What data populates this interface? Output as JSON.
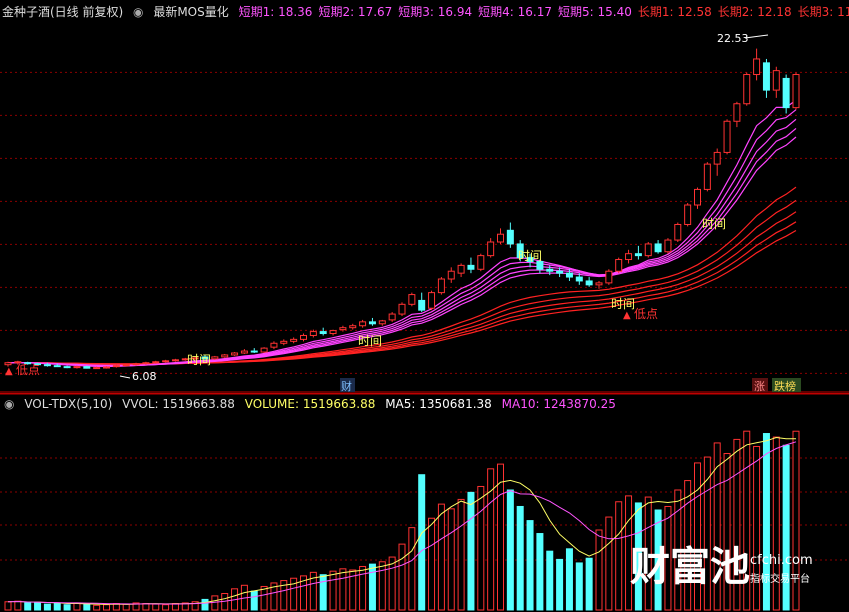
{
  "header": {
    "stock_title": "金种子酒(日线 前复权)",
    "indicator_name": "最新MOS量化",
    "values": [
      {
        "label": "短期1: 18.36",
        "color": "#ff55ff"
      },
      {
        "label": "短期2: 17.67",
        "color": "#ff55ff"
      },
      {
        "label": "短期3: 16.94",
        "color": "#ff55ff"
      },
      {
        "label": "短期4: 16.17",
        "color": "#ff55ff"
      },
      {
        "label": "短期5: 15.40",
        "color": "#ff55ff"
      },
      {
        "label": "长期1: 12.58",
        "color": "#ff3333"
      },
      {
        "label": "长期2: 12.18",
        "color": "#ff3333"
      },
      {
        "label": "长期3: 11",
        "color": "#ff3333"
      }
    ]
  },
  "volume_header": {
    "name": "VOL-TDX(5,10)",
    "vvol": "VVOL: 1519663.88",
    "volume": "VOLUME: 1519663.88",
    "ma5": "MA5: 1350681.38",
    "ma10": "MA10: 1243870.25"
  },
  "annotations": {
    "high_label": "22.53",
    "low_label": "6.08",
    "time_label": "时间",
    "low_point_label": "低点",
    "cai_label": "财",
    "zhang_label": "涨",
    "diebang_label": "跌榜"
  },
  "watermark": {
    "main": "财富池",
    "domain": "cfchi.com",
    "sub": "指标交易平台"
  },
  "colors": {
    "up": "#ff3232",
    "down": "#54ffff",
    "short_ma": "#ff44ff",
    "long_ma": "#ff2222",
    "grid": "#8b0000",
    "label": "#ffff66"
  },
  "chart_data": [
    {
      "type": "candlestick",
      "title": "金种子酒(日线 前复权)",
      "ylim": [
        5.0,
        24.0
      ],
      "ohlc": [
        [
          6.3,
          6.45,
          6.2,
          6.4
        ],
        [
          6.4,
          6.5,
          6.3,
          6.45
        ],
        [
          6.4,
          6.45,
          6.3,
          6.35
        ],
        [
          6.35,
          6.4,
          6.25,
          6.3
        ],
        [
          6.3,
          6.4,
          6.2,
          6.25
        ],
        [
          6.25,
          6.35,
          6.18,
          6.22
        ],
        [
          6.2,
          6.25,
          6.12,
          6.15
        ],
        [
          6.15,
          6.25,
          6.1,
          6.2
        ],
        [
          6.2,
          6.25,
          6.1,
          6.12
        ],
        [
          6.12,
          6.2,
          6.08,
          6.15
        ],
        [
          6.15,
          6.22,
          6.1,
          6.18
        ],
        [
          6.2,
          6.3,
          6.15,
          6.25
        ],
        [
          6.25,
          6.35,
          6.2,
          6.3
        ],
        [
          6.3,
          6.4,
          6.25,
          6.35
        ],
        [
          6.35,
          6.45,
          6.3,
          6.4
        ],
        [
          6.4,
          6.5,
          6.35,
          6.45
        ],
        [
          6.45,
          6.55,
          6.4,
          6.5
        ],
        [
          6.5,
          6.6,
          6.45,
          6.55
        ],
        [
          6.55,
          6.65,
          6.5,
          6.6
        ],
        [
          6.6,
          6.7,
          6.55,
          6.65
        ],
        [
          6.7,
          6.8,
          6.6,
          6.6
        ],
        [
          6.6,
          6.75,
          6.55,
          6.7
        ],
        [
          6.7,
          6.85,
          6.65,
          6.8
        ],
        [
          6.8,
          6.95,
          6.75,
          6.9
        ],
        [
          6.9,
          7.1,
          6.85,
          7.0
        ],
        [
          7.0,
          7.15,
          6.9,
          6.95
        ],
        [
          6.95,
          7.2,
          6.9,
          7.15
        ],
        [
          7.2,
          7.5,
          7.1,
          7.4
        ],
        [
          7.4,
          7.6,
          7.3,
          7.5
        ],
        [
          7.5,
          7.7,
          7.4,
          7.6
        ],
        [
          7.6,
          7.9,
          7.5,
          7.8
        ],
        [
          7.8,
          8.1,
          7.7,
          8.0
        ],
        [
          8.0,
          8.2,
          7.8,
          7.9
        ],
        [
          7.9,
          8.1,
          7.8,
          8.05
        ],
        [
          8.1,
          8.3,
          8.0,
          8.2
        ],
        [
          8.2,
          8.4,
          8.1,
          8.3
        ],
        [
          8.3,
          8.6,
          8.2,
          8.5
        ],
        [
          8.5,
          8.7,
          8.3,
          8.4
        ],
        [
          8.4,
          8.6,
          8.3,
          8.55
        ],
        [
          8.6,
          9.0,
          8.5,
          8.9
        ],
        [
          8.9,
          9.5,
          8.8,
          9.4
        ],
        [
          9.4,
          10.0,
          9.3,
          9.9
        ],
        [
          9.6,
          10.0,
          9.0,
          9.1
        ],
        [
          9.2,
          10.1,
          9.1,
          10.0
        ],
        [
          10.0,
          10.8,
          9.9,
          10.7
        ],
        [
          10.7,
          11.3,
          10.5,
          11.1
        ],
        [
          11.0,
          11.5,
          10.8,
          11.4
        ],
        [
          11.4,
          11.8,
          11.0,
          11.2
        ],
        [
          11.2,
          12.0,
          11.1,
          11.9
        ],
        [
          11.9,
          12.8,
          11.8,
          12.6
        ],
        [
          12.6,
          13.3,
          12.5,
          13.0
        ],
        [
          13.2,
          13.6,
          12.3,
          12.5
        ],
        [
          12.5,
          12.7,
          11.6,
          11.8
        ],
        [
          11.8,
          12.0,
          11.3,
          11.6
        ],
        [
          11.6,
          11.7,
          11.0,
          11.2
        ],
        [
          11.2,
          11.4,
          10.9,
          11.1
        ],
        [
          11.1,
          11.3,
          10.8,
          11.0
        ],
        [
          11.0,
          11.2,
          10.6,
          10.8
        ],
        [
          10.8,
          11.0,
          10.4,
          10.6
        ],
        [
          10.6,
          10.8,
          10.3,
          10.4
        ],
        [
          10.4,
          10.6,
          10.2,
          10.5
        ],
        [
          10.5,
          11.2,
          10.4,
          11.1
        ],
        [
          11.1,
          11.8,
          11.0,
          11.7
        ],
        [
          11.7,
          12.2,
          11.5,
          12.0
        ],
        [
          12.0,
          12.4,
          11.7,
          11.9
        ],
        [
          11.9,
          12.6,
          11.8,
          12.5
        ],
        [
          12.5,
          12.7,
          12.0,
          12.1
        ],
        [
          12.1,
          12.8,
          12.0,
          12.7
        ],
        [
          12.7,
          13.6,
          12.6,
          13.5
        ],
        [
          13.5,
          14.6,
          13.4,
          14.5
        ],
        [
          14.5,
          15.4,
          14.3,
          15.3
        ],
        [
          15.3,
          16.7,
          15.2,
          16.6
        ],
        [
          16.6,
          17.4,
          16.0,
          17.2
        ],
        [
          17.2,
          18.9,
          17.1,
          18.8
        ],
        [
          18.8,
          19.8,
          18.5,
          19.7
        ],
        [
          19.7,
          21.3,
          19.6,
          21.2
        ],
        [
          21.2,
          22.53,
          20.9,
          22.0
        ],
        [
          21.8,
          22.0,
          20.0,
          20.4
        ],
        [
          20.4,
          21.6,
          20.0,
          21.4
        ],
        [
          21.0,
          21.2,
          19.2,
          19.5
        ],
        [
          19.5,
          21.3,
          19.4,
          21.2
        ]
      ]
    },
    {
      "type": "bar",
      "title": "VOL-TDX(5,10)",
      "ylim": [
        0,
        1700000
      ],
      "values": [
        70000,
        75000,
        60000,
        65000,
        50000,
        55000,
        45000,
        60000,
        50000,
        40000,
        45000,
        55000,
        50000,
        60000,
        55000,
        50000,
        45000,
        55000,
        60000,
        70000,
        90000,
        120000,
        140000,
        180000,
        210000,
        160000,
        200000,
        230000,
        250000,
        270000,
        290000,
        320000,
        300000,
        330000,
        350000,
        340000,
        370000,
        390000,
        410000,
        450000,
        560000,
        700000,
        1150000,
        780000,
        900000,
        860000,
        940000,
        1000000,
        1050000,
        1200000,
        1240000,
        1020000,
        880000,
        760000,
        650000,
        500000,
        430000,
        520000,
        400000,
        440000,
        680000,
        790000,
        920000,
        970000,
        910000,
        960000,
        850000,
        880000,
        1020000,
        1100000,
        1250000,
        1300000,
        1420000,
        1330000,
        1450000,
        1520000,
        1390000,
        1500000,
        1470000,
        1400000,
        1519664
      ],
      "series": [
        {
          "name": "MA5",
          "values_last": 1350681.38
        },
        {
          "name": "MA10",
          "values_last": 1243870.25
        }
      ]
    }
  ]
}
